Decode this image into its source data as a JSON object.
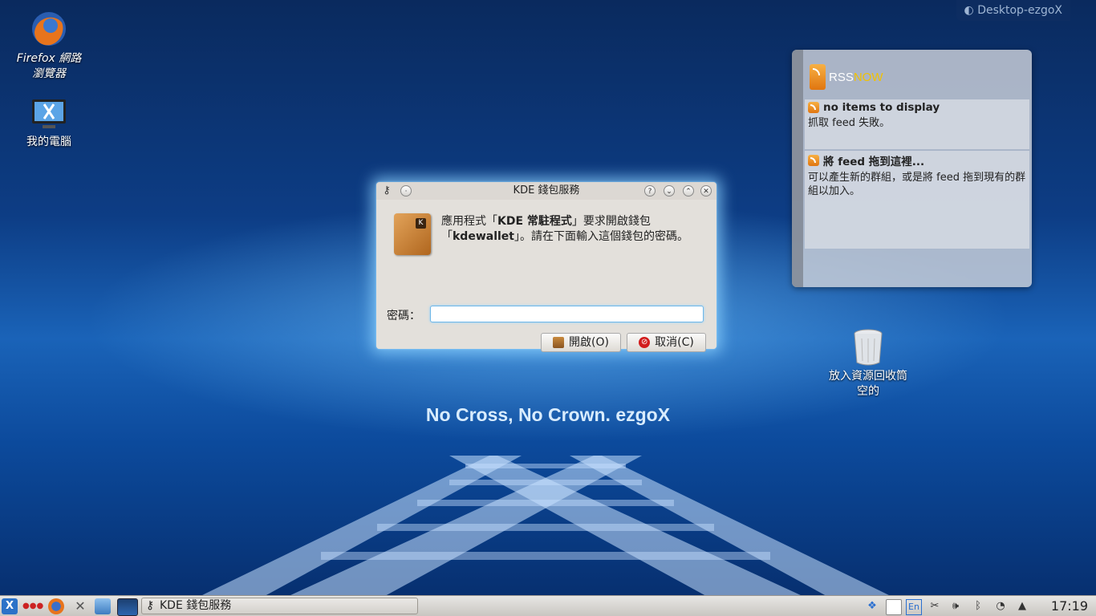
{
  "desktop": {
    "activity_label": "Desktop-ezgoX",
    "slogan": "No Cross, No Crown.   ezgoX",
    "icons": [
      {
        "label": "Firefox 網路\n瀏覽器"
      },
      {
        "label": "我的電腦"
      }
    ],
    "trash": {
      "line1": "放入資源回收筒",
      "line2": "空的"
    }
  },
  "rss_widget": {
    "logo_a": "RSS",
    "logo_b": "NOW",
    "feeds": [
      {
        "title": "no items to display",
        "desc": "抓取 feed 失敗。"
      },
      {
        "title": "將 feed 拖到這裡...",
        "desc": "可以產生新的群組，或是將 feed 拖到現有的群組以加入。"
      }
    ]
  },
  "dialog": {
    "title": "KDE 錢包服務",
    "message_part1": "應用程式「",
    "app_name": "KDE 常駐程式",
    "message_part2": "」要求開啟錢包「",
    "wallet_name": "kdewallet",
    "message_part3": "」。請在下面輸入這個錢包的密碼。",
    "password_label": "密碼：",
    "password_value": "",
    "open_button": "開啟(O)",
    "cancel_button": "取消(C)",
    "help_glyph": "?",
    "min_glyph": "⌄",
    "max_glyph": "⌃",
    "close_glyph": "✕"
  },
  "taskbar": {
    "task_label": "KDE 錢包服務",
    "lang_indicator": "En",
    "clock": "17:19"
  }
}
